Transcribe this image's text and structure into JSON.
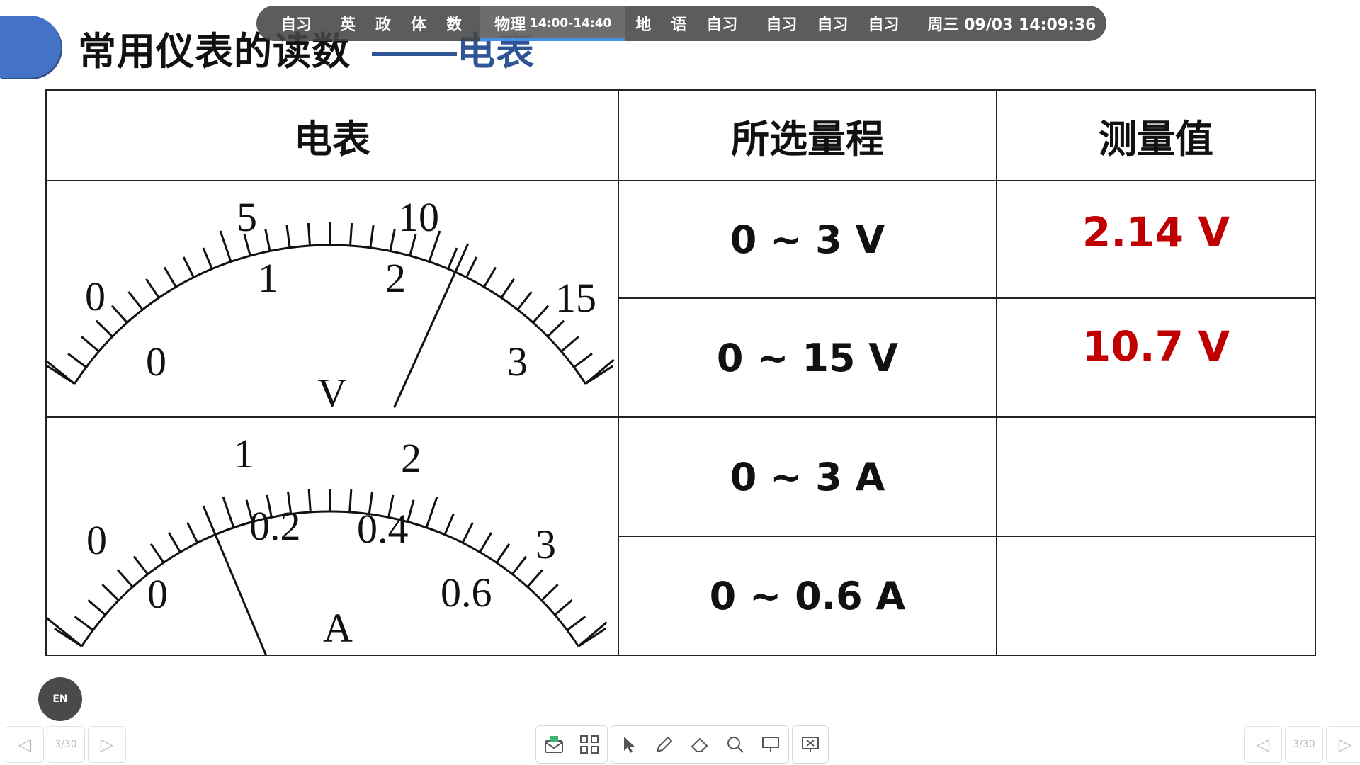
{
  "slide": {
    "title": "常用仪表的读数",
    "subtitle": "电表"
  },
  "schedule": {
    "items": [
      {
        "label": "自习"
      },
      {
        "label": "英"
      },
      {
        "label": "政"
      },
      {
        "label": "体"
      },
      {
        "label": "数"
      },
      {
        "label": "物理",
        "time": "14:00-14:40",
        "current": true
      },
      {
        "label": "地"
      },
      {
        "label": "语"
      },
      {
        "label": "自习"
      },
      {
        "label": "自习"
      },
      {
        "label": "自习"
      },
      {
        "label": "自习"
      }
    ],
    "datetime": "周三 09/03   14:09:36"
  },
  "table": {
    "headers": {
      "meter": "电表",
      "range": "所选量程",
      "reading": "测量值"
    },
    "rows": [
      {
        "range": "0 ~ 3 V",
        "reading": "2.14 V"
      },
      {
        "range": "0 ~ 15 V",
        "reading": "10.7 V"
      },
      {
        "range": "0 ~ 3 A",
        "reading": ""
      },
      {
        "range": "0 ~ 0.6 A",
        "reading": ""
      }
    ]
  },
  "voltmeter": {
    "unit": "V",
    "top_labels": [
      "0",
      "5",
      "10",
      "15"
    ],
    "bottom_labels": [
      "0",
      "1",
      "2",
      "3"
    ],
    "needle_fraction": 0.713
  },
  "ammeter": {
    "unit": "A",
    "top_labels": [
      "0",
      "1",
      "2",
      "3"
    ],
    "bottom_labels": [
      "0",
      "0.2",
      "0.4",
      "0.6"
    ],
    "needle_fraction": 0.3
  },
  "controls": {
    "en_label": "EN",
    "page_indicator": "3/30"
  },
  "colors": {
    "accent": "#4472c4",
    "answer": "#c00000",
    "title_sub": "#2f5597"
  }
}
